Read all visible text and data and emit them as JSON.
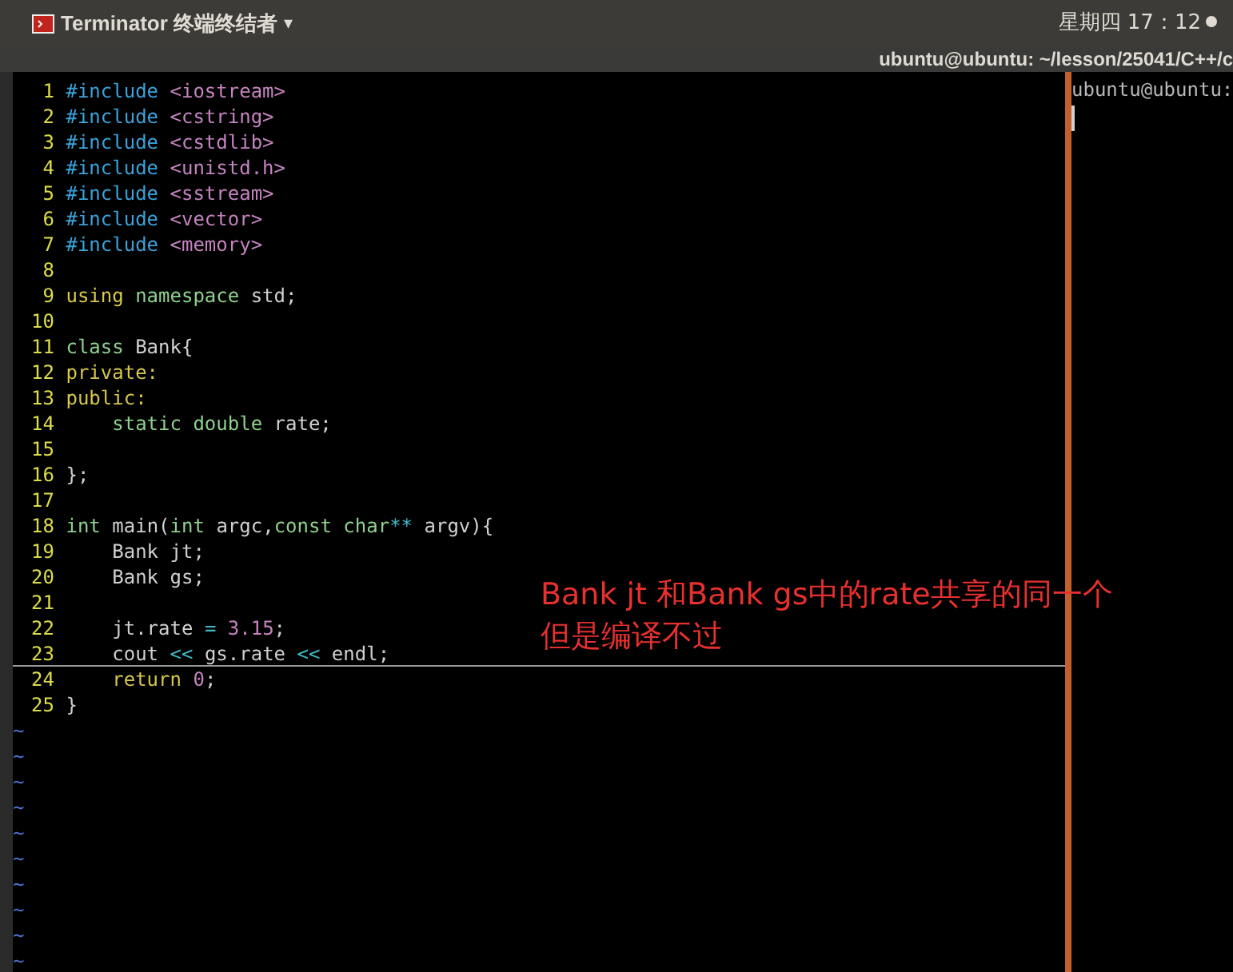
{
  "top_bar": {
    "app_title": "Terminator 终端终结者",
    "menu_caret": "▾",
    "clock": "星期四 17：12"
  },
  "window": {
    "title": "ubuntu@ubuntu: ~/lesson/25041/C++/c"
  },
  "editor": {
    "lines": [
      {
        "number": "1",
        "tokens": [
          {
            "text": "#include",
            "color": "#3aa3dc"
          },
          {
            "text": " <iostream>",
            "color": "#c583c0"
          }
        ]
      },
      {
        "number": "2",
        "tokens": [
          {
            "text": "#include",
            "color": "#3aa3dc"
          },
          {
            "text": " <cstring>",
            "color": "#c583c0"
          }
        ]
      },
      {
        "number": "3",
        "tokens": [
          {
            "text": "#include",
            "color": "#3aa3dc"
          },
          {
            "text": " <cstdlib>",
            "color": "#c583c0"
          }
        ]
      },
      {
        "number": "4",
        "tokens": [
          {
            "text": "#include",
            "color": "#3aa3dc"
          },
          {
            "text": " <unistd.h>",
            "color": "#c583c0"
          }
        ]
      },
      {
        "number": "5",
        "tokens": [
          {
            "text": "#include",
            "color": "#3aa3dc"
          },
          {
            "text": " <sstream>",
            "color": "#c583c0"
          }
        ]
      },
      {
        "number": "6",
        "tokens": [
          {
            "text": "#include",
            "color": "#3aa3dc"
          },
          {
            "text": " <vector>",
            "color": "#c583c0"
          }
        ]
      },
      {
        "number": "7",
        "tokens": [
          {
            "text": "#include",
            "color": "#3aa3dc"
          },
          {
            "text": " <memory>",
            "color": "#c583c0"
          }
        ]
      },
      {
        "number": "8"
      },
      {
        "number": "9",
        "tokens": [
          {
            "text": "using",
            "color": "#d7c74a"
          },
          {
            "text": " namespace",
            "color": "#8fd18f"
          },
          {
            "text": " std;"
          }
        ]
      },
      {
        "number": "10"
      },
      {
        "number": "11",
        "tokens": [
          {
            "text": "class",
            "color": "#8fd18f"
          },
          {
            "text": " Bank{"
          }
        ]
      },
      {
        "number": "12",
        "tokens": [
          {
            "text": "private:",
            "color": "#d7c74a"
          }
        ]
      },
      {
        "number": "13",
        "tokens": [
          {
            "text": "public:",
            "color": "#d7c74a"
          }
        ]
      },
      {
        "number": "14",
        "tokens": [
          {
            "text": "    static double",
            "color": "#8fd18f"
          },
          {
            "text": " rate;"
          }
        ]
      },
      {
        "number": "15"
      },
      {
        "number": "16",
        "tokens": [
          {
            "text": "};"
          }
        ]
      },
      {
        "number": "17"
      },
      {
        "number": "18",
        "tokens": [
          {
            "text": "int",
            "color": "#8fd18f"
          },
          {
            "text": " main("
          },
          {
            "text": "int",
            "color": "#8fd18f"
          },
          {
            "text": " argc,"
          },
          {
            "text": "const char",
            "color": "#8fd18f"
          },
          {
            "text": "**",
            "color": "#3fb8c8"
          },
          {
            "text": " argv){"
          }
        ]
      },
      {
        "number": "19",
        "tokens": [
          {
            "text": "    Bank jt;"
          }
        ]
      },
      {
        "number": "20",
        "tokens": [
          {
            "text": "    Bank gs;"
          }
        ]
      },
      {
        "number": "21"
      },
      {
        "number": "22",
        "tokens": [
          {
            "text": "    jt.rate "
          },
          {
            "text": "=",
            "color": "#3fb8c8"
          },
          {
            "text": " 3.15",
            "color": "#c583c0"
          },
          {
            "text": ";"
          }
        ]
      },
      {
        "number": "23",
        "tokens": [
          {
            "text": "    cout "
          },
          {
            "text": "<<",
            "color": "#3fb8c8"
          },
          {
            "text": " gs.rate "
          },
          {
            "text": "<<",
            "color": "#3fb8c8"
          },
          {
            "text": " endl;"
          }
        ],
        "cursor_line": true
      },
      {
        "number": "24",
        "tokens": [
          {
            "text": "    return",
            "color": "#d7c74a"
          },
          {
            "text": " 0",
            "color": "#c583c0"
          },
          {
            "text": ";"
          }
        ]
      },
      {
        "number": "25",
        "tokens": [
          {
            "text": "}"
          }
        ]
      }
    ],
    "empty_markers": [
      "~",
      "~",
      "~",
      "~",
      "~",
      "~",
      "~",
      "~",
      "~",
      "~"
    ]
  },
  "annotation": {
    "lines": [
      "Bank jt 和Bank gs中的rate共享的同一个",
      "但是编译不过"
    ]
  },
  "right_pane": {
    "prompt": "ubuntu@ubuntu:"
  }
}
